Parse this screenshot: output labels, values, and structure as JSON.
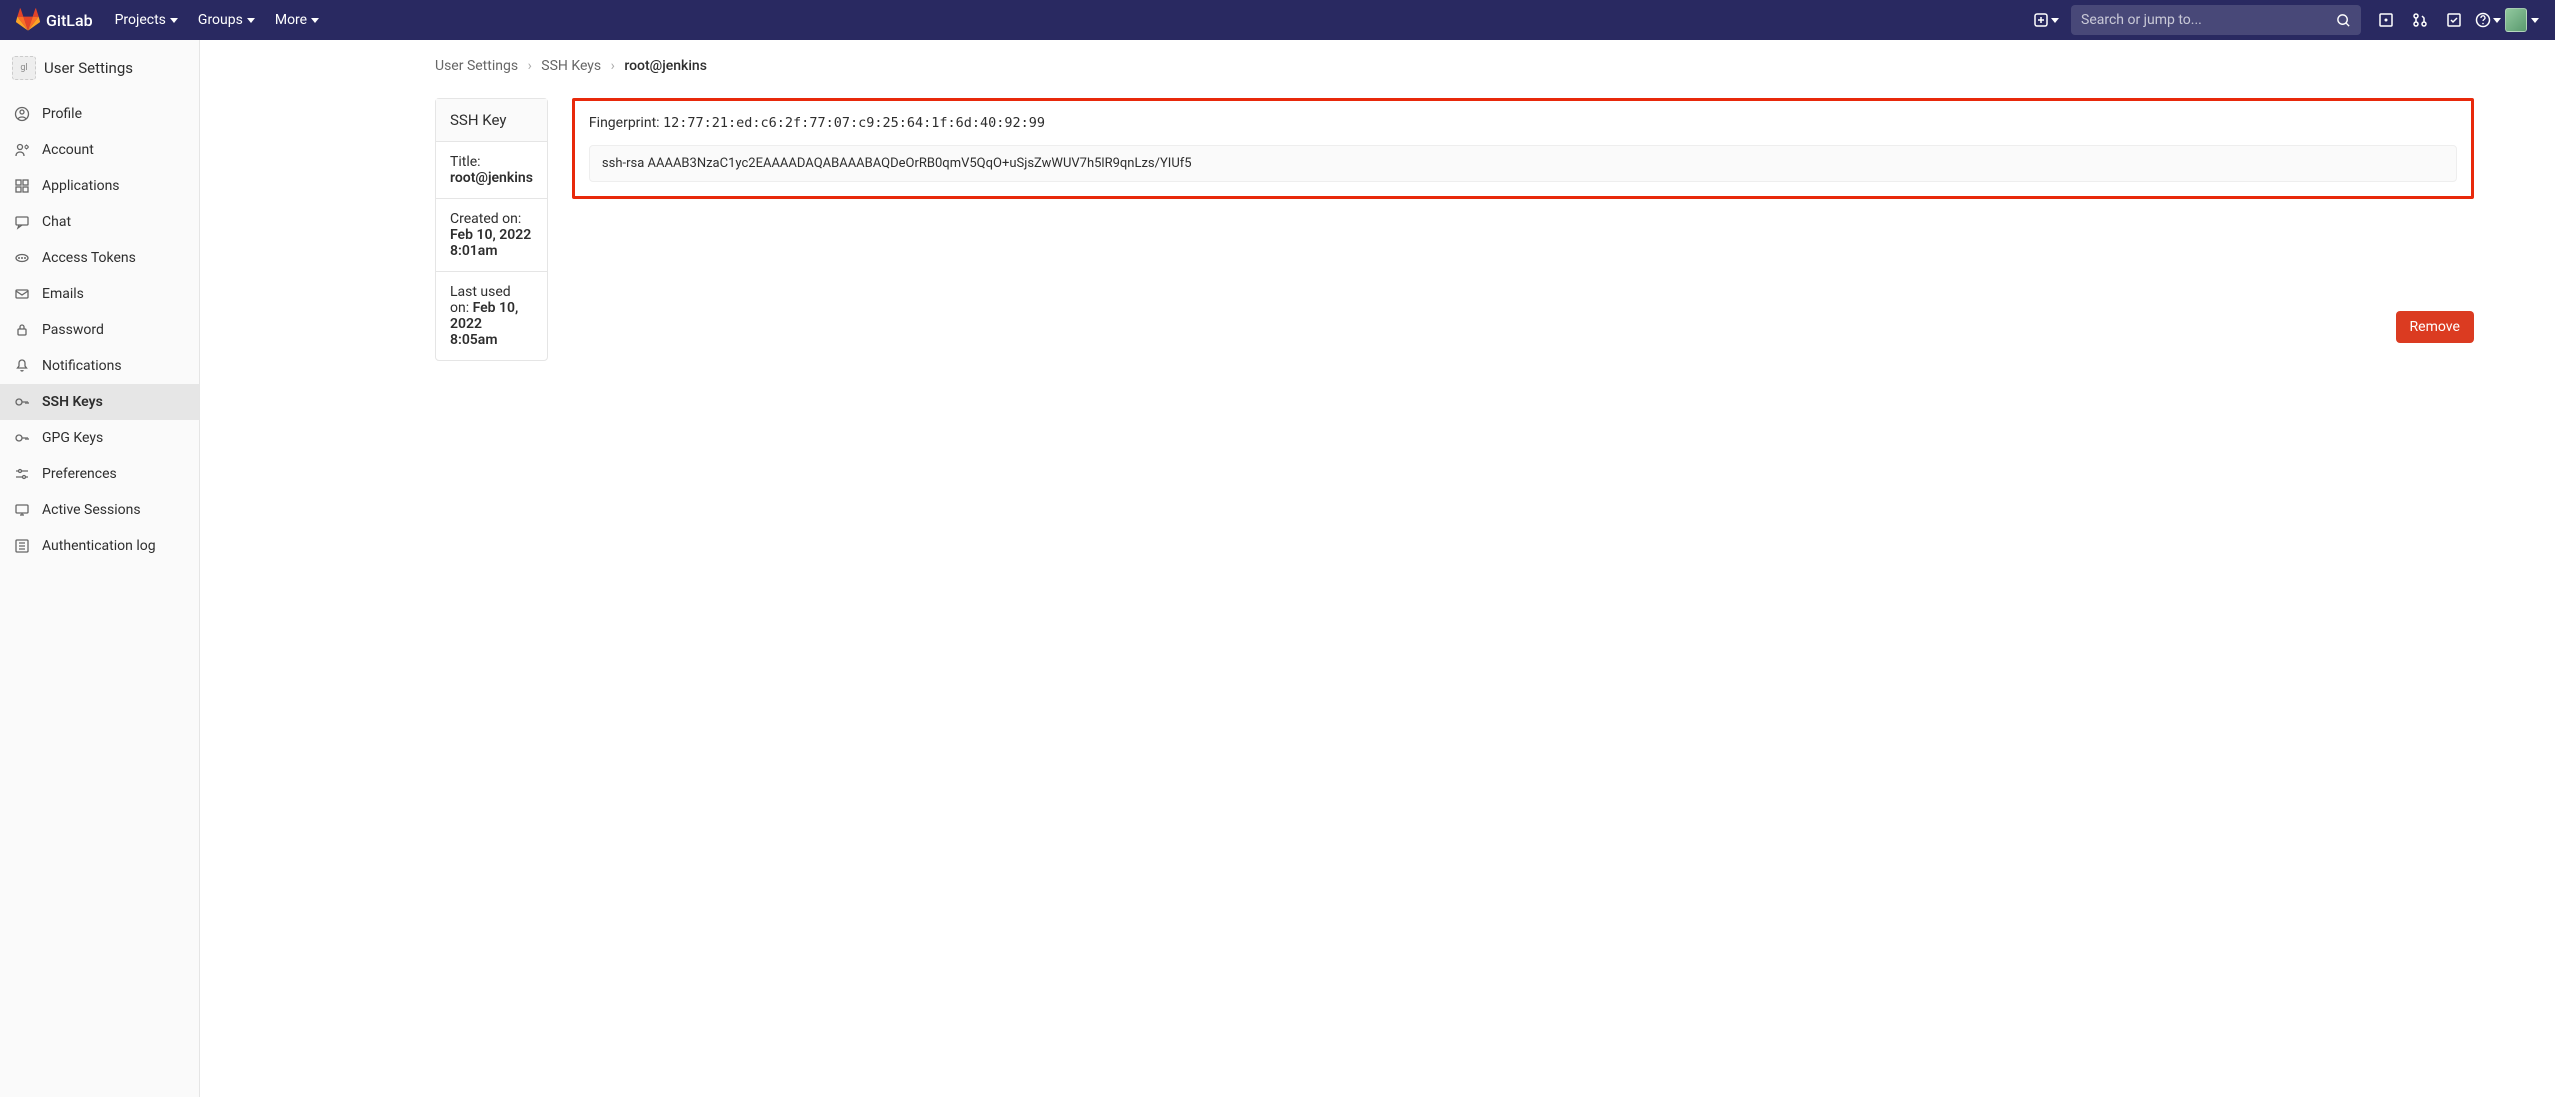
{
  "topbar": {
    "brand": "GitLab",
    "nav": [
      {
        "label": "Projects"
      },
      {
        "label": "Groups"
      },
      {
        "label": "More"
      }
    ],
    "search_placeholder": "Search or jump to..."
  },
  "sidebar": {
    "header": "User Settings",
    "header_icon_alt": "gl",
    "items": [
      {
        "label": "Profile",
        "icon": "user-circle"
      },
      {
        "label": "Account",
        "icon": "user-gear"
      },
      {
        "label": "Applications",
        "icon": "apps"
      },
      {
        "label": "Chat",
        "icon": "chat"
      },
      {
        "label": "Access Tokens",
        "icon": "token"
      },
      {
        "label": "Emails",
        "icon": "mail"
      },
      {
        "label": "Password",
        "icon": "lock"
      },
      {
        "label": "Notifications",
        "icon": "bell"
      },
      {
        "label": "SSH Keys",
        "icon": "key",
        "active": true
      },
      {
        "label": "GPG Keys",
        "icon": "key"
      },
      {
        "label": "Preferences",
        "icon": "sliders"
      },
      {
        "label": "Active Sessions",
        "icon": "monitor"
      },
      {
        "label": "Authentication log",
        "icon": "list"
      }
    ]
  },
  "breadcrumbs": {
    "items": [
      "User Settings",
      "SSH Keys"
    ],
    "current": "root@jenkins"
  },
  "card": {
    "header": "SSH Key",
    "title_label": "Title: ",
    "title_value": "root@jenkins",
    "created_label": "Created on: ",
    "created_value": "Feb 10, 2022 8:01am",
    "lastused_label": "Last used on: ",
    "lastused_value": "Feb 10, 2022 8:05am"
  },
  "fingerprint": {
    "label": "Fingerprint: ",
    "value": "12:77:21:ed:c6:2f:77:07:c9:25:64:1f:6d:40:92:99"
  },
  "ssh_key": "ssh-rsa AAAAB3NzaC1yc2EAAAADAQABAAABAQDeOrRB0qmV5QqO+uSjsZwWUV7h5lR9qnLzs/YIUf5",
  "remove_label": "Remove"
}
